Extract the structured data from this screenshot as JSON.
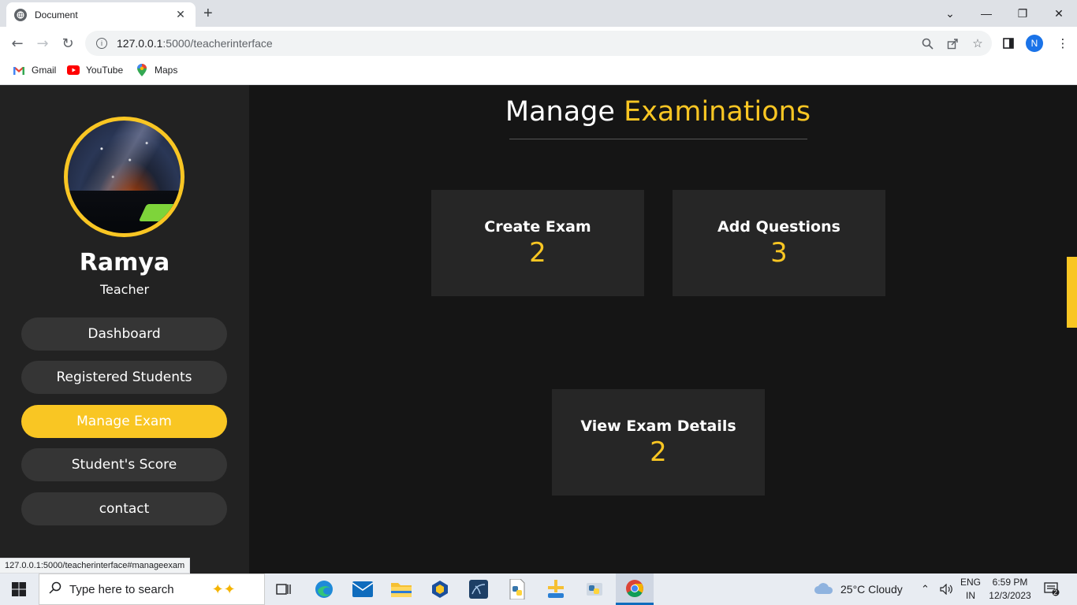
{
  "browser": {
    "tab_title": "Document",
    "url_host": "127.0.0.1",
    "url_path": ":5000/teacherinterface",
    "profile_initial": "N",
    "bookmarks": [
      {
        "label": "Gmail",
        "icon": "gmail-icon"
      },
      {
        "label": "YouTube",
        "icon": "youtube-icon"
      },
      {
        "label": "Maps",
        "icon": "maps-icon"
      }
    ],
    "status_url": "127.0.0.1:5000/teacherinterface#manageexam"
  },
  "sidebar": {
    "user_name": "Ramya",
    "user_role": "Teacher",
    "nav": [
      {
        "label": "Dashboard"
      },
      {
        "label": "Registered Students"
      },
      {
        "label": "Manage Exam"
      },
      {
        "label": "Student's Score"
      },
      {
        "label": "contact"
      }
    ],
    "active_index": 2
  },
  "main": {
    "title_prefix": "Manage",
    "title_accent": "Examinations",
    "cards": [
      {
        "label": "Create Exam",
        "count": "2"
      },
      {
        "label": "Add Questions",
        "count": "3"
      },
      {
        "label": "View Exam Details",
        "count": "2"
      }
    ]
  },
  "taskbar": {
    "search_placeholder": "Type here to search",
    "weather": "25°C  Cloudy",
    "lang_line1": "ENG",
    "lang_line2": "IN",
    "time": "6:59 PM",
    "date": "12/3/2023",
    "notification_count": "2"
  },
  "colors": {
    "accent": "#f9c623",
    "sidebar_bg": "#222222",
    "page_bg": "#151515",
    "card_bg": "#262626"
  }
}
